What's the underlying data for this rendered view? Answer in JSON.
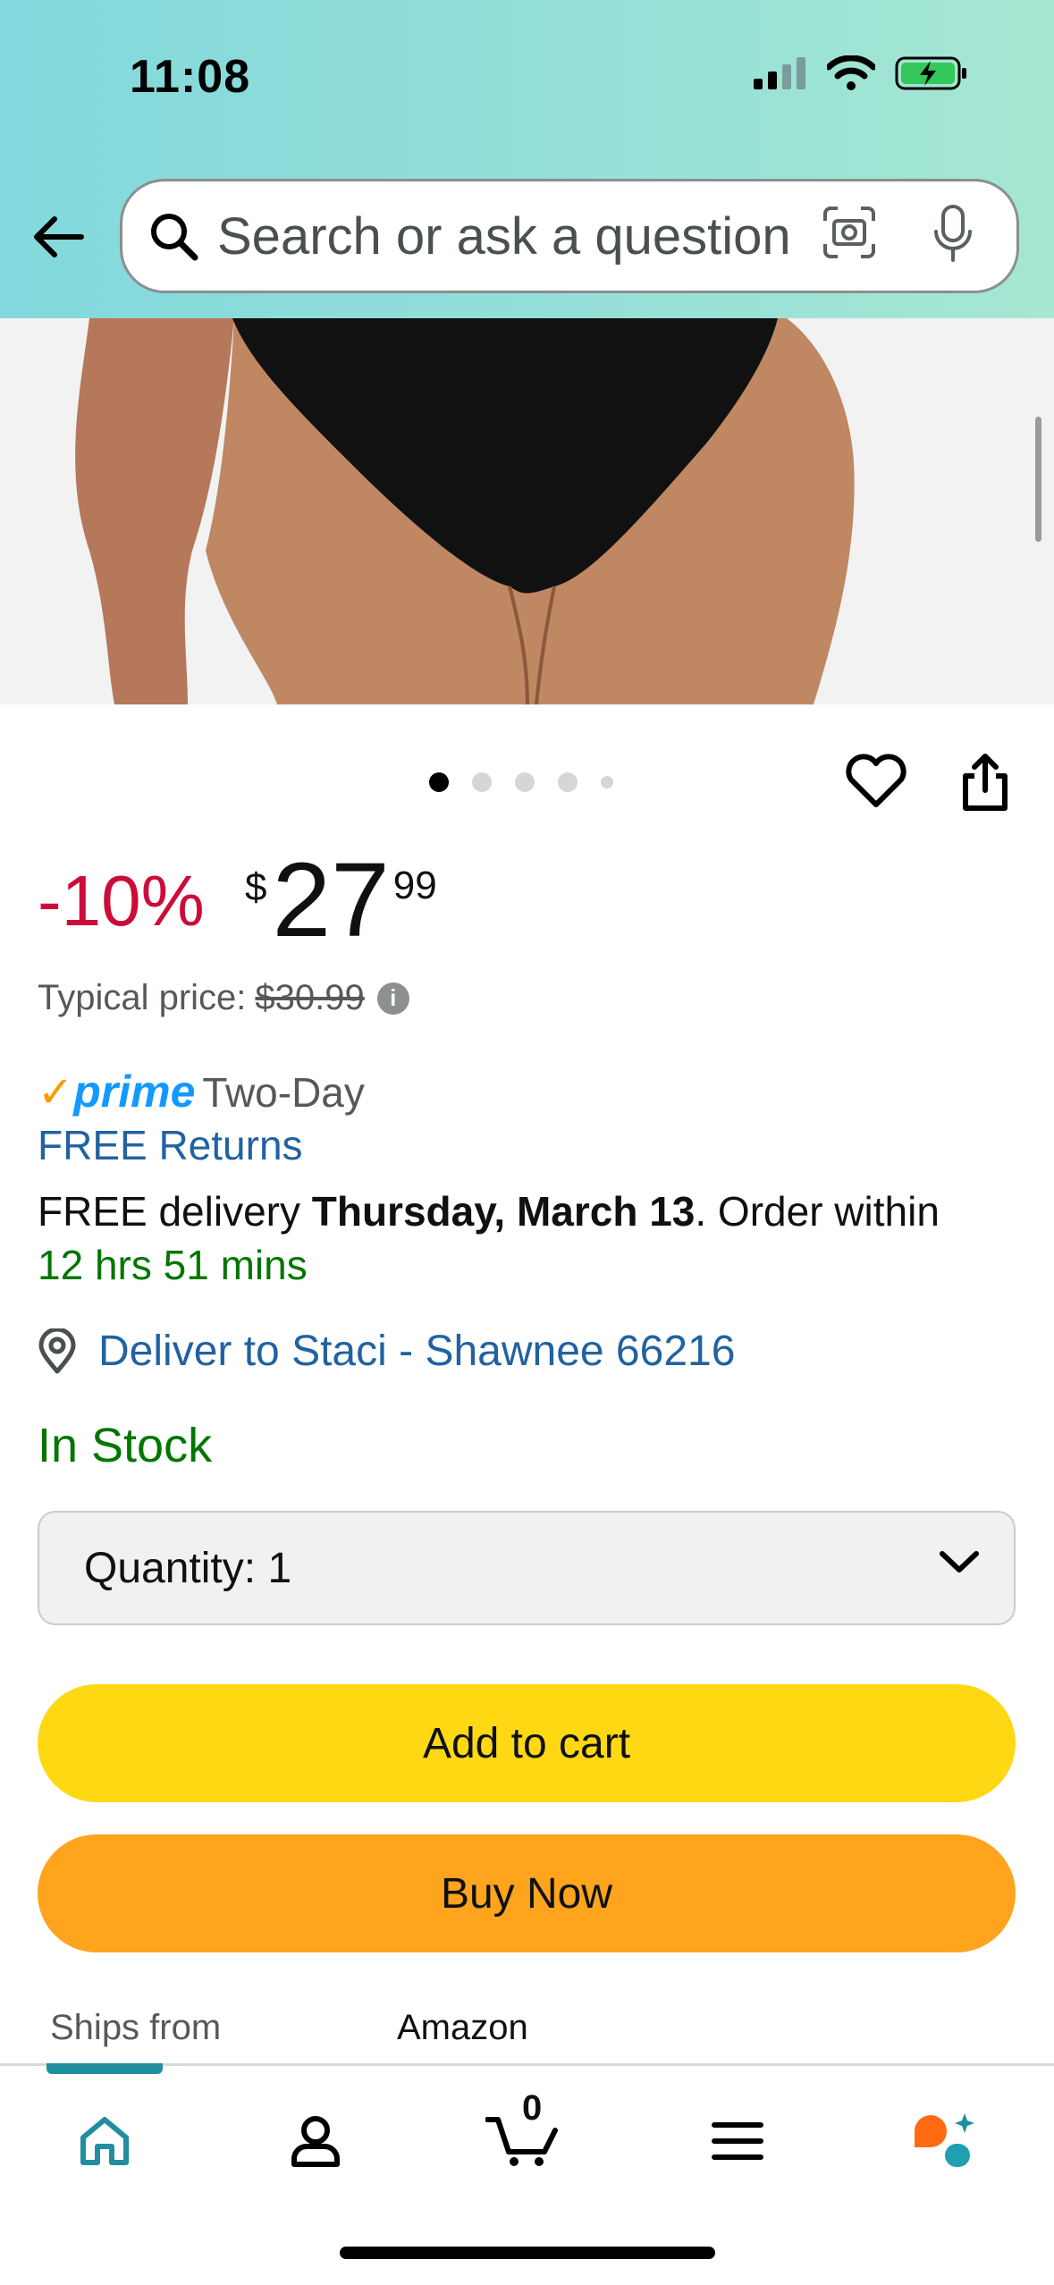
{
  "status_bar": {
    "time": "11:08"
  },
  "search": {
    "placeholder": "Search or ask a question"
  },
  "gallery": {
    "page_count": 5,
    "current_page": 1
  },
  "price": {
    "discount": "-10%",
    "currency_symbol": "$",
    "whole": "27",
    "fraction": "99",
    "typical_label": "Typical price:",
    "typical_value": "$30.99"
  },
  "delivery": {
    "prime_word": "prime",
    "prime_label": "Two-Day",
    "free_returns": "FREE Returns",
    "free_delivery_prefix": "FREE delivery",
    "date": "Thursday, March 13",
    "order_within_suffix": ". Order within",
    "countdown": "12 hrs 51 mins",
    "deliver_to": "Deliver to Staci - Shawnee 66216"
  },
  "stock_status": "In Stock",
  "quantity": {
    "label": "Quantity:",
    "value": "1"
  },
  "buttons": {
    "add_to_cart": "Add to cart",
    "buy_now": "Buy Now"
  },
  "ships_from": {
    "label": "Ships from",
    "value": "Amazon"
  },
  "tabbar": {
    "cart_count": "0"
  },
  "colors": {
    "discount": "#cc0c39",
    "link": "#2162a1",
    "in_stock": "#007600",
    "add_to_cart": "#ffd814",
    "buy_now": "#ffa41c",
    "prime_blue": "#1399ff",
    "prime_check": "#ff9900"
  }
}
